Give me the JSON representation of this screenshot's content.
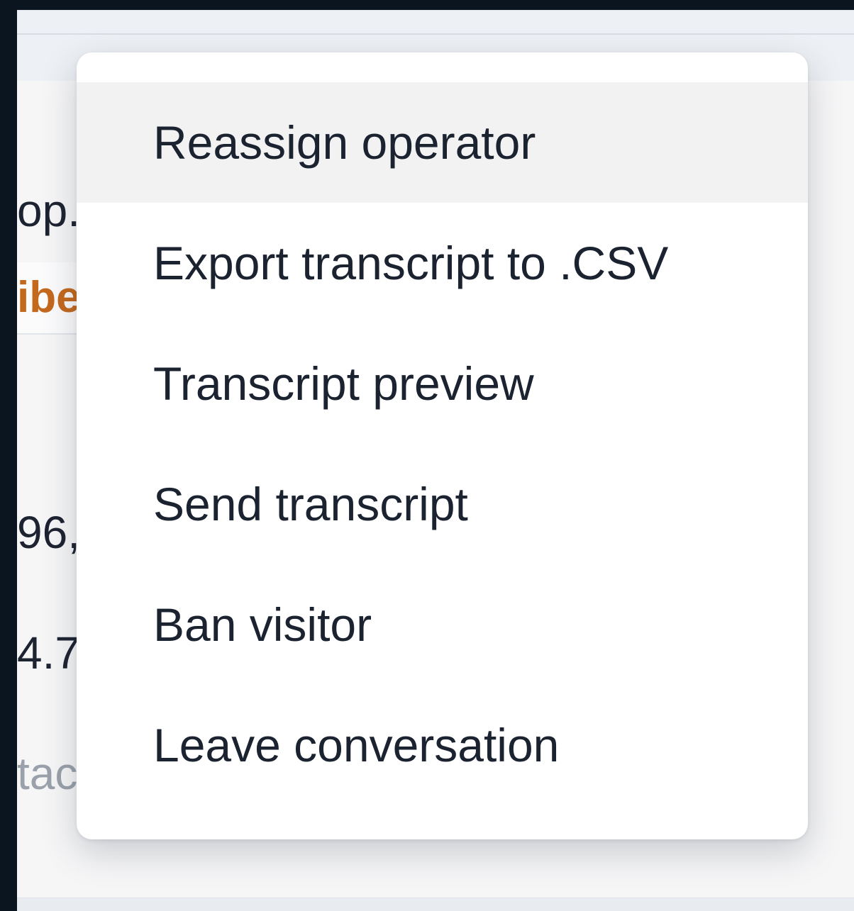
{
  "background_panel": {
    "snippets": [
      "op.",
      "96,",
      "4.7",
      "tac"
    ],
    "tag_text": "ibe"
  },
  "context_menu": {
    "items": [
      {
        "label": "Reassign operator",
        "highlighted": true
      },
      {
        "label": "Export transcript to .CSV",
        "highlighted": false
      },
      {
        "label": "Transcript preview",
        "highlighted": false
      },
      {
        "label": "Send transcript",
        "highlighted": false
      },
      {
        "label": "Ban visitor",
        "highlighted": false
      },
      {
        "label": "Leave conversation",
        "highlighted": false
      }
    ]
  },
  "colors": {
    "tag_text": "#c4681d",
    "menu_highlight": "#f2f2f3"
  }
}
